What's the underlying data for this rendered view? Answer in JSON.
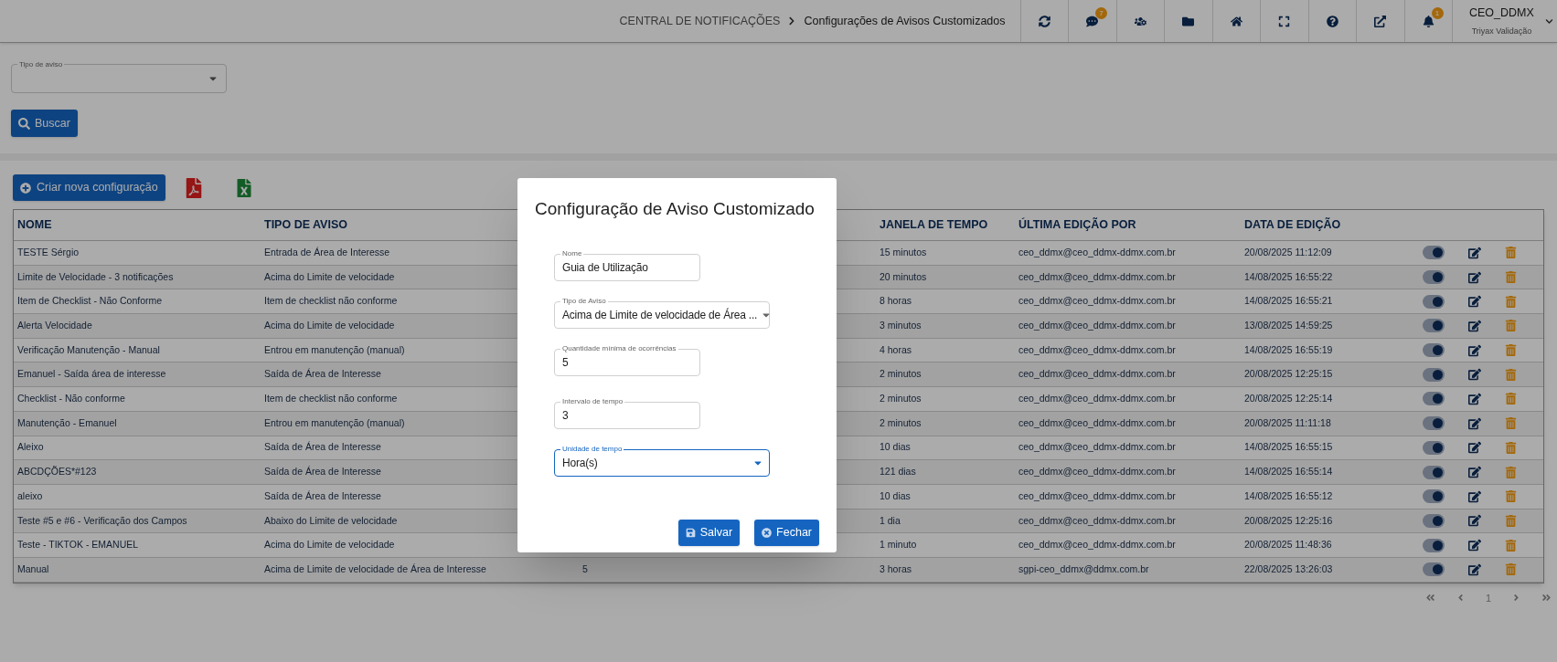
{
  "header": {
    "breadcrumb": [
      "CENTRAL DE NOTIFICAÇÕES",
      "Configurações de Avisos Customizados"
    ],
    "toolbar": [
      {
        "kind": "refresh"
      },
      {
        "kind": "chat",
        "badge": "7"
      },
      {
        "kind": "users"
      },
      {
        "kind": "folders"
      },
      {
        "kind": "home"
      },
      {
        "kind": "fullscreen"
      },
      {
        "kind": "help"
      },
      {
        "kind": "external"
      },
      {
        "kind": "bell",
        "badge": "1"
      }
    ],
    "user": {
      "name": "CEO_DDMX",
      "org": "Triyax Validação"
    }
  },
  "filter": {
    "label": "Tipo de aviso"
  },
  "search_button": "Buscar",
  "create_button": "Criar nova configuração",
  "table": {
    "columns": {
      "name": "NOME",
      "type": "TIPO DE AVISO",
      "window": "JANELA DE TEMPO",
      "editor": "ÚLTIMA EDIÇÃO POR",
      "edited": "DATA DE EDIÇÃO"
    },
    "rows": [
      {
        "name": "TESTE Sérgio",
        "type": "Entrada de Área de Interesse",
        "window": "15 minutos",
        "editor": "ceo_ddmx@ceo_ddmx-ddmx.com.br",
        "edited": "20/08/2025 11:12:09",
        "on": true
      },
      {
        "name": "Limite de Velocidade - 3 notificações",
        "type": "Acima do Limite de velocidade",
        "window": "20 minutos",
        "editor": "ceo_ddmx@ceo_ddmx-ddmx.com.br",
        "edited": "14/08/2025 16:55:22",
        "on": true
      },
      {
        "name": "Item de Checklist - Não Conforme",
        "type": "Item de checklist não conforme",
        "window": "8 horas",
        "editor": "ceo_ddmx@ceo_ddmx-ddmx.com.br",
        "edited": "14/08/2025 16:55:21",
        "on": true
      },
      {
        "name": "Alerta Velocidade",
        "type": "Acima do Limite de velocidade",
        "window": "3 minutos",
        "editor": "ceo_ddmx@ceo_ddmx-ddmx.com.br",
        "edited": "13/08/2025 14:59:25",
        "on": true
      },
      {
        "name": "Verificação Manutenção - Manual",
        "type": "Entrou em manutenção (manual)",
        "window": "4 horas",
        "editor": "ceo_ddmx@ceo_ddmx-ddmx.com.br",
        "edited": "14/08/2025 16:55:19",
        "on": true
      },
      {
        "name": "Emanuel - Saída área de interesse",
        "type": "Saída de Área de Interesse",
        "window": "2 minutos",
        "editor": "ceo_ddmx@ceo_ddmx-ddmx.com.br",
        "edited": "20/08/2025 12:25:15",
        "on": true
      },
      {
        "name": "Checklist - Não conforme",
        "type": "Item de checklist não conforme",
        "window": "2 minutos",
        "editor": "ceo_ddmx@ceo_ddmx-ddmx.com.br",
        "edited": "20/08/2025 12:25:14",
        "on": true
      },
      {
        "name": "Manutenção - Emanuel",
        "type": "Entrou em manutenção (manual)",
        "window": "2 minutos",
        "editor": "ceo_ddmx@ceo_ddmx-ddmx.com.br",
        "edited": "20/08/2025 11:11:18",
        "on": true
      },
      {
        "name": "Aleixo",
        "type": "Saída de Área de Interesse",
        "window": "10 dias",
        "editor": "ceo_ddmx@ceo_ddmx-ddmx.com.br",
        "edited": "14/08/2025 16:55:15",
        "on": true
      },
      {
        "name": "ABCDÇÕES*#123",
        "type": "Saída de Área de Interesse",
        "window": "121 dias",
        "editor": "ceo_ddmx@ceo_ddmx-ddmx.com.br",
        "edited": "14/08/2025 16:55:14",
        "on": true
      },
      {
        "name": "aleixo",
        "type": "Saída de Área de Interesse",
        "window": "10 dias",
        "editor": "ceo_ddmx@ceo_ddmx-ddmx.com.br",
        "edited": "14/08/2025 16:55:12",
        "on": true
      },
      {
        "name": "Teste #5 e #6 - Verificação dos Campos",
        "type": "Abaixo do Limite de velocidade",
        "window": "1 dia",
        "editor": "ceo_ddmx@ceo_ddmx-ddmx.com.br",
        "edited": "20/08/2025 12:25:16",
        "on": true
      },
      {
        "name": "Teste - TIKTOK - EMANUEL",
        "type": "Acima do Limite de velocidade",
        "window": "1 minuto",
        "editor": "ceo_ddmx@ceo_ddmx-ddmx.com.br",
        "edited": "20/08/2025 11:48:36",
        "on": true
      },
      {
        "name": "Manual",
        "type": "Acima de Limite de velocidade de Área de Interesse",
        "column_3": "5",
        "window": "3 horas",
        "editor": "sgpi-ceo_ddmx@ddmx.com.br",
        "edited": "22/08/2025 13:26:03",
        "on": true
      }
    ]
  },
  "pagination": {
    "page": "1"
  },
  "modal": {
    "title": "Configuração de Aviso Customizado",
    "fields": [
      {
        "kind": "text",
        "label": "Nome",
        "value": "Guia de Utilização",
        "focused": false
      },
      {
        "kind": "select",
        "label": "Tipo de Aviso",
        "value": "Acima de Limite de velocidade de Área ...",
        "focused": false
      },
      {
        "kind": "text",
        "label": "Quantidade mínima de ocorrências",
        "value": "5",
        "focused": false
      },
      {
        "kind": "text",
        "label": "Intervalo de tempo",
        "value": "3",
        "focused": false
      },
      {
        "kind": "select",
        "label": "Unidade de tempo",
        "value": "Hora(s)",
        "focused": true
      }
    ],
    "buttons": [
      {
        "kind": "save",
        "label": "Salvar"
      },
      {
        "kind": "close",
        "label": "Fechar"
      }
    ]
  }
}
